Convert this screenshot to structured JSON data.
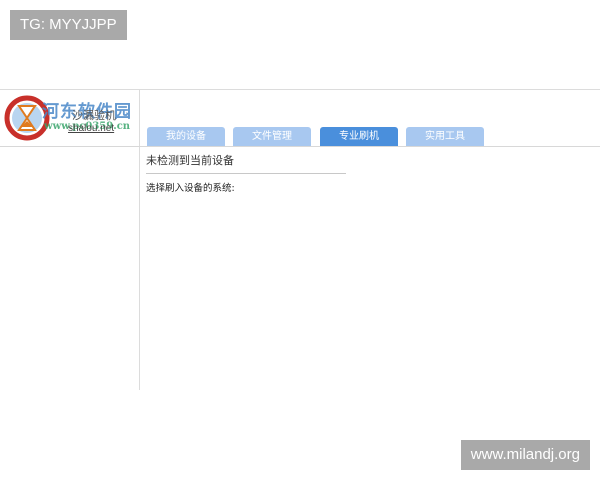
{
  "overlay": {
    "tag_text": "TG: MYYJJPP",
    "site_url": "www.milandj.org"
  },
  "header": {
    "app_name": "沙漏验机",
    "app_site": "shalou.net",
    "watermark_title": "河东软件园",
    "watermark_url": "www.pc0359.cn"
  },
  "tabs": [
    {
      "label": "我的设备",
      "active": false
    },
    {
      "label": "文件管理",
      "active": false
    },
    {
      "label": "专业刷机",
      "active": true
    },
    {
      "label": "实用工具",
      "active": false
    }
  ],
  "main": {
    "device_status": "未检测到当前设备",
    "system_select_label": "选择刷入设备的系统:"
  },
  "colors": {
    "tab_active": "#4a8fdc",
    "tab_inactive": "#a8c8f0",
    "overlay_bg": "#a9a9a9"
  }
}
